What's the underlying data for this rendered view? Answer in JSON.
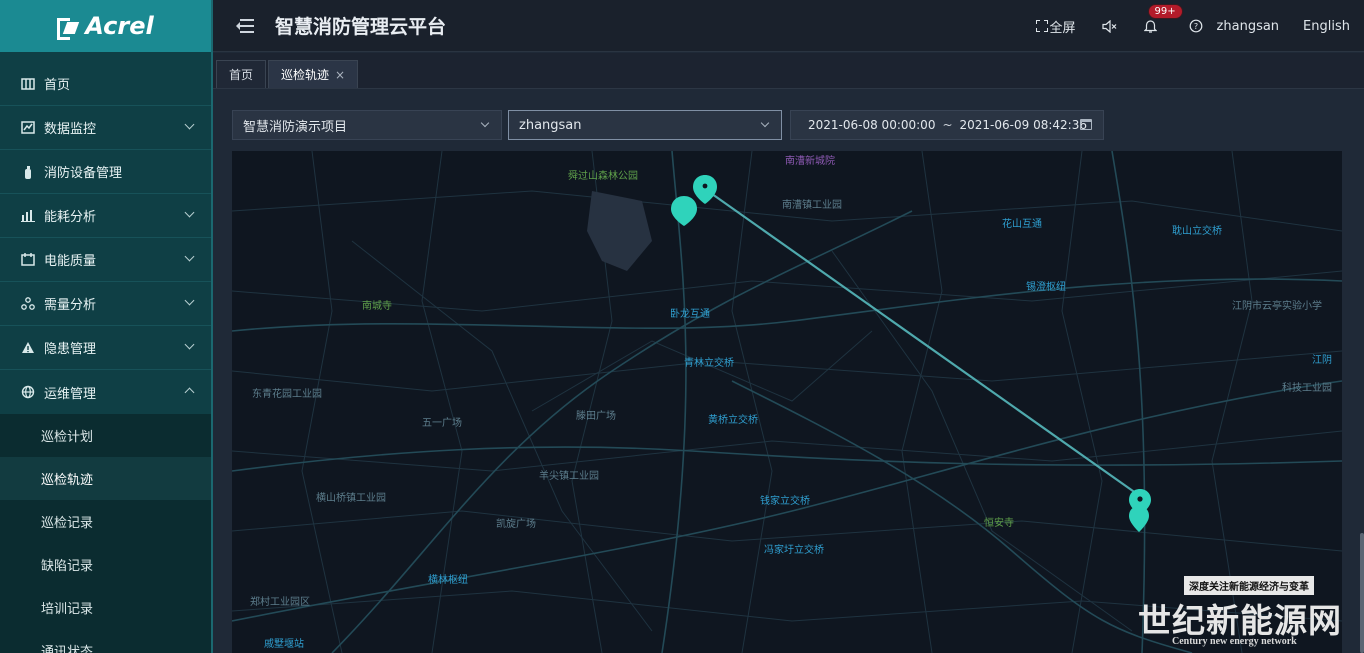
{
  "brand": {
    "logo_text": "Acrel"
  },
  "header": {
    "title": "智慧消防管理云平台",
    "fullscreen_label": "全屏",
    "notifications_badge": "99+",
    "username": "zhangsan",
    "language": "English"
  },
  "sidebar": {
    "items": [
      {
        "label": "首页",
        "icon": "home-icon"
      },
      {
        "label": "数据监控",
        "icon": "monitor-icon"
      },
      {
        "label": "消防设备管理",
        "icon": "extinguisher-icon"
      },
      {
        "label": "能耗分析",
        "icon": "bar-chart-icon"
      },
      {
        "label": "电能质量",
        "icon": "calendar-icon"
      },
      {
        "label": "需量分析",
        "icon": "nodes-icon"
      },
      {
        "label": "隐患管理",
        "icon": "warning-icon"
      },
      {
        "label": "运维管理",
        "icon": "globe-icon"
      }
    ],
    "submenu": [
      "巡检计划",
      "巡检轨迹",
      "巡检记录",
      "缺陷记录",
      "培训记录",
      "通讯状态"
    ]
  },
  "tabs": [
    {
      "label": "首页",
      "active": false
    },
    {
      "label": "巡检轨迹",
      "active": true,
      "close": "×"
    }
  ],
  "filters": {
    "project": "智慧消防演示项目",
    "user": "zhangsan",
    "date_start": "2021-06-08 00:00:00",
    "date_sep": "~",
    "date_end": "2021-06-09 08:42:36"
  },
  "map": {
    "labels": [
      "舜过山森林公园",
      "南漕镇工业园",
      "南漕新城院",
      "花山互通",
      "耽山立交桥",
      "南城寺",
      "卧龙互通",
      "锡澄枢纽",
      "江阴市云亭实验小学",
      "青林立交桥",
      "东青花园工业园",
      "五一广场",
      "滕田广场",
      "黄桥立交桥",
      "羊尖镇工业园",
      "凯旋广场",
      "钱家立交桥",
      "冯家圩立交桥",
      "恒安寺",
      "横山桥镇工业园",
      "横林枢纽",
      "郑村工业园区",
      "戚墅堰站",
      "江阴",
      "科技工业园"
    ]
  },
  "watermark": {
    "tagline": "深度关注新能源经济与变革",
    "name": "世纪新能源网",
    "english": "Century new energy network"
  },
  "colors": {
    "sidebar_bg": "#0f3f45",
    "logo_bg": "#1b8a92",
    "track": "#4fa9ad",
    "marker": "#2fd3bb",
    "map_bg": "#0f1620"
  }
}
